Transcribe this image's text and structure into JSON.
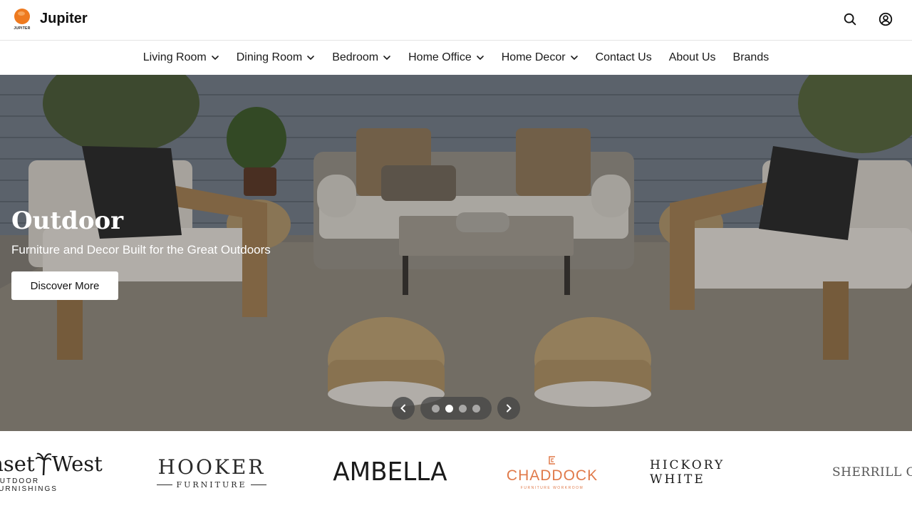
{
  "header": {
    "logo_name": "Jupiter",
    "logo_tag": "JUPITER",
    "icons": [
      "search-icon",
      "account-icon"
    ]
  },
  "nav": {
    "items": [
      {
        "label": "Living Room",
        "dropdown": true
      },
      {
        "label": "Dining Room",
        "dropdown": true
      },
      {
        "label": "Bedroom",
        "dropdown": true
      },
      {
        "label": "Home Office",
        "dropdown": true
      },
      {
        "label": "Home Decor",
        "dropdown": true
      },
      {
        "label": "Contact Us",
        "dropdown": false
      },
      {
        "label": "About Us",
        "dropdown": false
      },
      {
        "label": "Brands",
        "dropdown": false
      }
    ]
  },
  "hero": {
    "title": "Outdoor",
    "subtitle": "Furniture and Decor Built for the Great Outdoors",
    "cta_label": "Discover More",
    "slide_count": 4,
    "active_slide": 2
  },
  "brands": {
    "items": [
      {
        "name": "nset",
        "name2": "West",
        "sub": "OUTDOOR FURNISHINGS"
      },
      {
        "name": "HOOKER",
        "sub": "FURNITURE"
      },
      {
        "name": "AMBELLA"
      },
      {
        "name": "CHADDOCK",
        "sub": "FURNITURE WORKROOM",
        "color": "#e07a4a"
      },
      {
        "name": "HICKORY WHITE"
      },
      {
        "name": "SHERRILL OCCA"
      }
    ]
  },
  "colors": {
    "logo_orange": "#ee7a1f",
    "chaddock_orange": "#e07a4a"
  }
}
